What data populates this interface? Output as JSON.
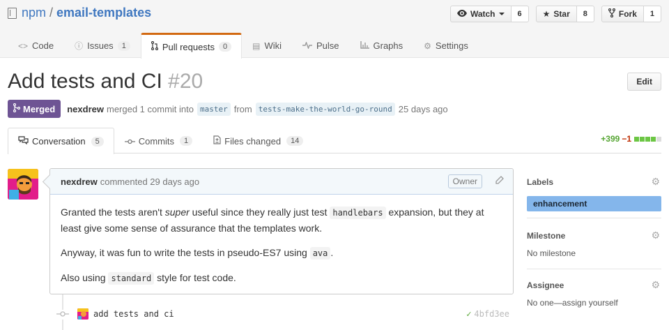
{
  "repo": {
    "owner": "npm",
    "separator": "/",
    "name": "email-templates"
  },
  "actions": {
    "watch_label": "Watch",
    "watch_count": "6",
    "star_label": "Star",
    "star_count": "8",
    "fork_label": "Fork",
    "fork_count": "1"
  },
  "nav": {
    "code": "Code",
    "issues": "Issues",
    "issues_count": "1",
    "pulls": "Pull requests",
    "pulls_count": "0",
    "wiki": "Wiki",
    "pulse": "Pulse",
    "graphs": "Graphs",
    "settings": "Settings"
  },
  "pr": {
    "title": "Add tests and CI",
    "number": "#20",
    "edit_label": "Edit",
    "state": "Merged",
    "author": "nexdrew",
    "merged_text": "merged 1 commit into",
    "base_branch": "master",
    "from_text": "from",
    "head_branch": "tests-make-the-world-go-round",
    "time": "25 days ago"
  },
  "tabs": {
    "conversation": "Conversation",
    "conversation_count": "5",
    "commits": "Commits",
    "commits_count": "1",
    "files": "Files changed",
    "files_count": "14"
  },
  "diffstat": {
    "additions": "+399",
    "deletions": "−1",
    "colors": [
      "#6cc644",
      "#6cc644",
      "#6cc644",
      "#6cc644",
      "#ddd"
    ]
  },
  "comment": {
    "author": "nexdrew",
    "action": "commented 29 days ago",
    "owner_badge": "Owner",
    "p1_a": "Granted the tests aren't ",
    "p1_em": "super",
    "p1_b": " useful since they really just test ",
    "p1_code": "handlebars",
    "p1_c": " expansion, but they at least give some sense of assurance that the templates work.",
    "p2_a": "Anyway, it was fun to write the tests in pseudo-ES7 using ",
    "p2_code": "ava",
    "p2_b": ".",
    "p3_a": "Also using ",
    "p3_code": "standard",
    "p3_b": " style for test code."
  },
  "commit": {
    "message": "add tests and ci",
    "sha": "4bfd3ee"
  },
  "sidebar": {
    "labels_heading": "Labels",
    "label": "enhancement",
    "milestone_heading": "Milestone",
    "milestone_value": "No milestone",
    "assignee_heading": "Assignee",
    "assignee_value": "No one—assign yourself"
  }
}
